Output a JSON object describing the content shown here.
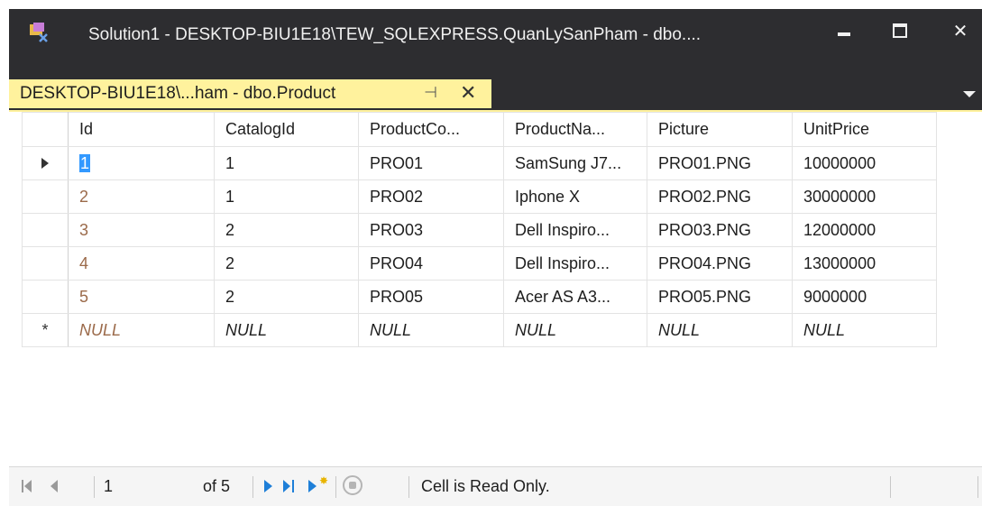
{
  "window": {
    "title": "Solution1 - DESKTOP-BIU1E18\\TEW_SQLEXPRESS.QuanLySanPham - dbo....",
    "close_glyph": "✕"
  },
  "tab": {
    "label": "DESKTOP-BIU1E18\\...ham - dbo.Product",
    "pin_glyph": "⊣",
    "close_glyph": "✕"
  },
  "grid": {
    "columns": [
      "Id",
      "CatalogId",
      "ProductCo...",
      "ProductNa...",
      "Picture",
      "UnitPrice"
    ],
    "rows": [
      [
        "1",
        "1",
        "PRO01",
        "SamSung J7...",
        "PRO01.PNG",
        "10000000"
      ],
      [
        "2",
        "1",
        "PRO02",
        "Iphone X",
        "PRO02.PNG",
        "30000000"
      ],
      [
        "3",
        "2",
        "PRO03",
        "Dell Inspiro...",
        "PRO03.PNG",
        "12000000"
      ],
      [
        "4",
        "2",
        "PRO04",
        "Dell Inspiro...",
        "PRO04.PNG",
        "13000000"
      ],
      [
        "5",
        "2",
        "PRO05",
        "Acer AS A3...",
        "PRO05.PNG",
        "9000000"
      ]
    ],
    "new_row": [
      "NULL",
      "NULL",
      "NULL",
      "NULL",
      "NULL",
      "NULL"
    ],
    "new_row_marker": "*"
  },
  "navigation": {
    "current_position": "1",
    "of_total": "of 5",
    "status_message": "Cell is Read Only."
  },
  "colors": {
    "tab_accent": "#fff29d",
    "selection": "#3399ff",
    "chrome": "#2d2d30",
    "id_text": "#9b6a4a",
    "nav_icon": "#1e7fd8"
  }
}
